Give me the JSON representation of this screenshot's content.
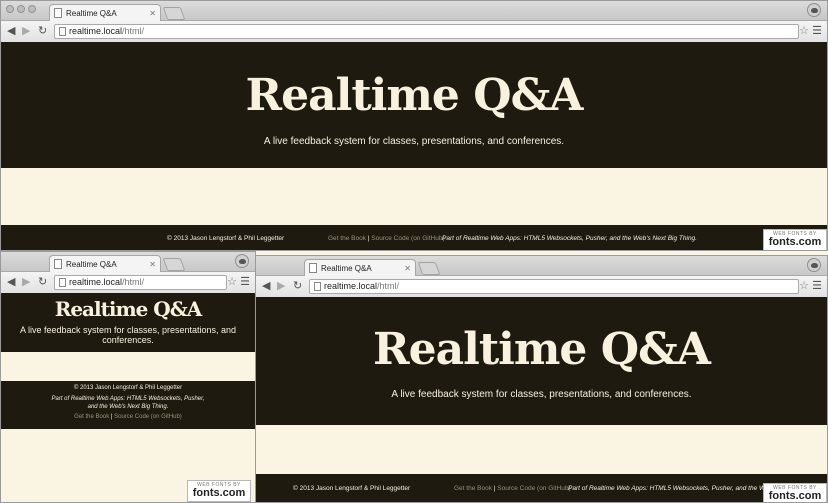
{
  "tab_title": "Realtime Q&A",
  "url_host": "realtime.local",
  "url_path": "/html/",
  "site": {
    "title": "Realtime Q&A",
    "tagline": "A live feedback system for classes, presentations, and conferences."
  },
  "footer": {
    "copyright": "© 2013 Jason Lengstorf & Phil Leggetter",
    "get_book": "Get the Book",
    "separator": "|",
    "source_code": "Source Code (on GitHub)",
    "part_of": "Part of Realtime Web Apps: HTML5 Websockets, Pusher, and the Web's Next Big Thing."
  },
  "badge": {
    "by": "WEB FONTS BY",
    "brand": "fonts.com"
  },
  "colors": {
    "dark": "#1e1a10",
    "cream": "#faf4e3",
    "light_text": "#f8f1de",
    "muted_link": "#9c9174"
  },
  "icons": {
    "back": "arrow-left-icon",
    "forward": "arrow-right-icon",
    "reload": "reload-icon",
    "star": "star-icon",
    "menu": "hamburger-menu-icon"
  }
}
